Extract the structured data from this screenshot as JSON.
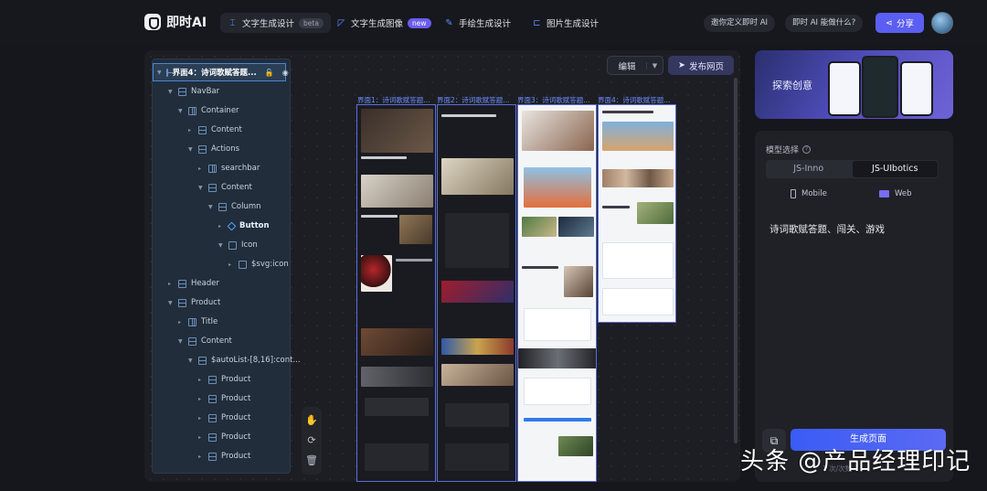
{
  "app": {
    "name": "即时AI"
  },
  "tabs": [
    {
      "label": "文字生成设计",
      "badge": "beta",
      "icon": "text-design-icon"
    },
    {
      "label": "文字生成图像",
      "badge": "new",
      "icon": "image-gen-icon"
    },
    {
      "label": "手绘生成设计",
      "badge": "",
      "icon": "sketch-icon"
    },
    {
      "label": "图片生成设计",
      "badge": "",
      "icon": "picture-design-icon"
    }
  ],
  "header": {
    "custom_ai": "邀你定义即时 AI",
    "what_can": "即时 AI 能做什么?",
    "share": "分享"
  },
  "toolbar": {
    "edit": "编辑",
    "publish": "发布网页"
  },
  "tree": {
    "selected": "界面4：诗词歌赋答题...",
    "items": [
      "NavBar",
      "Container",
      "Content",
      "Actions",
      "searchbar",
      "Content",
      "Column",
      "Button",
      "Icon",
      "$svg:icon",
      "Header",
      "Product",
      "Title",
      "Content",
      "$autoList-[8,16]:cont...",
      "Product",
      "Product",
      "Product",
      "Product",
      "Product"
    ]
  },
  "screens": [
    {
      "title": "界面1：诗词歌赋答题..."
    },
    {
      "title": "界面2：诗词歌赋答题..."
    },
    {
      "title": "界面3：诗词歌赋答题..."
    },
    {
      "title": "界面4：诗词歌赋答题..."
    }
  ],
  "banner": {
    "text": "探索创意"
  },
  "model": {
    "label": "模型选择",
    "options": [
      "JS-Inno",
      "JS-UIbotics"
    ],
    "selected": "JS-UIbotics",
    "devices": [
      "Mobile",
      "Web"
    ],
    "selected_device": "Web"
  },
  "prompt": "诗词歌赋答题、闯关、游戏",
  "generate": {
    "label": "生成页面",
    "sub": "1 次/次数"
  },
  "watermark": "头条 @产品经理印记",
  "colors": {
    "accent": "#5b5ef2",
    "screen_border": "#5a6fd8",
    "tree_bg": "#212d3a"
  }
}
